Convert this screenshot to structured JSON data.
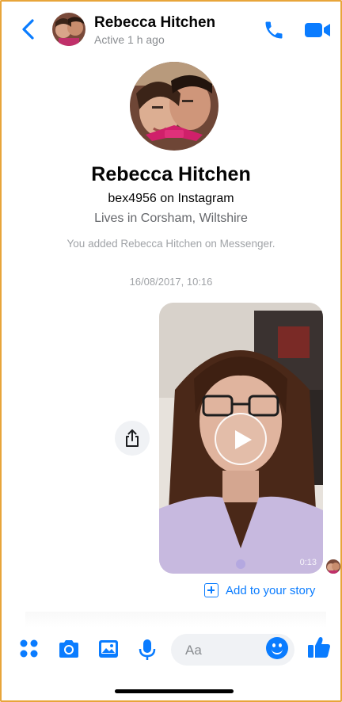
{
  "header": {
    "contact_name": "Rebecca Hitchen",
    "status": "Active 1 h ago",
    "icons": [
      "back-chevron-icon",
      "phone-icon",
      "video-camera-icon"
    ]
  },
  "profile": {
    "name": "Rebecca Hitchen",
    "instagram": "bex4956 on Instagram",
    "location": "Lives in Corsham, Wiltshire",
    "added_notice": "You added Rebecca Hitchen on Messenger."
  },
  "conversation": {
    "timestamp": "16/08/2017, 10:16",
    "video_message": {
      "duration": "0:13",
      "action_label": "Add to your story"
    }
  },
  "composer": {
    "placeholder": "Aa",
    "icons": [
      "apps-icon",
      "camera-icon",
      "gallery-icon",
      "microphone-icon",
      "emoji-icon",
      "thumbs-up-icon"
    ]
  },
  "colors": {
    "accent": "#0a7cff",
    "border": "#e8a53a",
    "secondary_text": "#8a8d91"
  }
}
